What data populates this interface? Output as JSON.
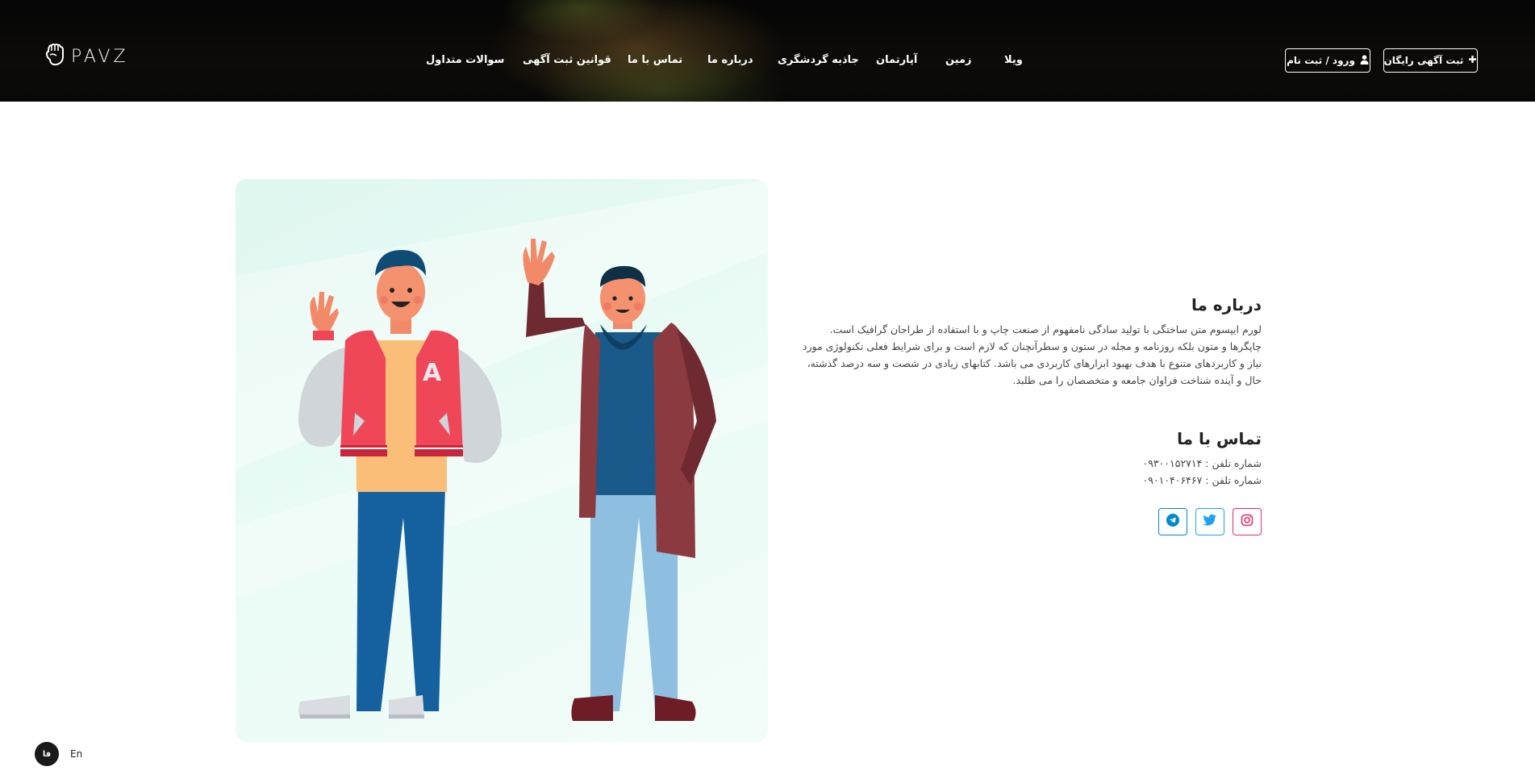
{
  "header": {
    "logo_text": "PAVZ",
    "nav": [
      {
        "label": "ویلا"
      },
      {
        "label": "زمین"
      },
      {
        "label": "آپارتمان"
      },
      {
        "label": "جاذبه گردشگری"
      },
      {
        "label": "درباره ما"
      },
      {
        "label": "تماس با ما"
      },
      {
        "label": "قوانین ثبت آگهی"
      },
      {
        "label": "سوالات متداول"
      }
    ],
    "free_ad_button": "ثبت آگهی رایگان",
    "login_button": "ورود / ثبت نام"
  },
  "about": {
    "title": "درباره ما",
    "lines": [
      "لورم ایپسوم متن ساختگی با تولید سادگی نامفهوم از صنعت چاپ و با استفاده از طراحان گرافیک است.",
      "چاپگرها و متون بلکه روزنامه و مجله در ستون و سطرآنچنان که لازم است و برای شرایط فعلی تکنولوژی مورد",
      "نیاز و کاربردهای متنوع با هدف بهبود ابزارهای کاربردی می باشد. کتابهای زیادی در شصت و سه درصد گذشته،",
      "حال و آینده شناخت فراوان جامعه و متخصصان را می طلبد."
    ]
  },
  "contact": {
    "title": "تماس با ما",
    "phones": [
      "شماره تلفن : ۰۹۳۰۰۱۵۲۷۱۴",
      "شماره تلفن : ۰۹۰۱۰۴۰۶۴۶۷"
    ],
    "socials": [
      {
        "icon": "instagram-icon",
        "color": "#e1306c"
      },
      {
        "icon": "twitter-icon",
        "color": "#1da1f2"
      },
      {
        "icon": "telegram-icon",
        "color": "#0088cc"
      }
    ]
  },
  "lang": {
    "fa": "فا",
    "en": "En"
  }
}
